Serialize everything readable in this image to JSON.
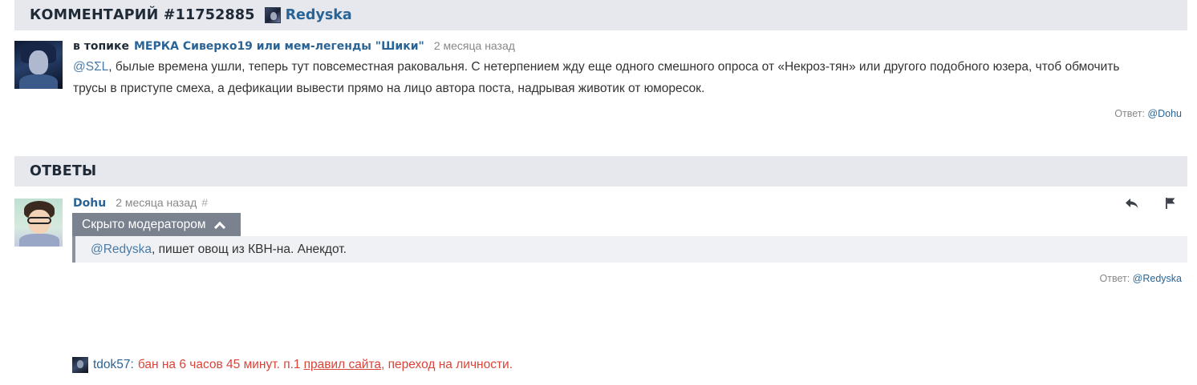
{
  "comment": {
    "header_title": "КОММЕНТАРИЙ #11752885",
    "header_user": "Redyska",
    "topic_prefix": "в топике",
    "topic_title": "МЕРКА Сиверко19 или мем-легенды \"Шики\"",
    "time": "2 месяца назад",
    "mention": "@SΣL",
    "text_line1": ", былые времена ушли, теперь тут повсеместная раковальня. С нетерпением жду еще одного смешного опроса от «Некроз-тян» или другого подобного юзера, чтоб обмочить",
    "text_line2": "трусы в приступе смеха, а дефикации вывести прямо на лицо автора поста, надрывая животик от юморесок.",
    "reply_label": "Ответ:",
    "reply_user": "@Dohu"
  },
  "replies": {
    "header_title": "ОТВЕТЫ",
    "author": "Dohu",
    "time": "2 месяца назад",
    "hash": "#",
    "hidden_label": "Скрыто модератором",
    "mention": "@Redyska",
    "text": ", пишет овощ из КВН-на. Анекдот.",
    "reply_label": "Ответ:",
    "reply_user": "@Redyska",
    "icons": [
      "reply-icon",
      "flag-icon"
    ]
  },
  "ban": {
    "user": "tdok57",
    "colon": ":",
    "text": "бан на 6 часов 45 минут. п.1",
    "link": "правил сайта",
    "tail": ", переход на личности."
  },
  "colors": {
    "link": "#2a6496",
    "header_bg": "#e6e8ee",
    "ban_red": "#d9443a",
    "hidden_label_bg": "#7a8290"
  }
}
